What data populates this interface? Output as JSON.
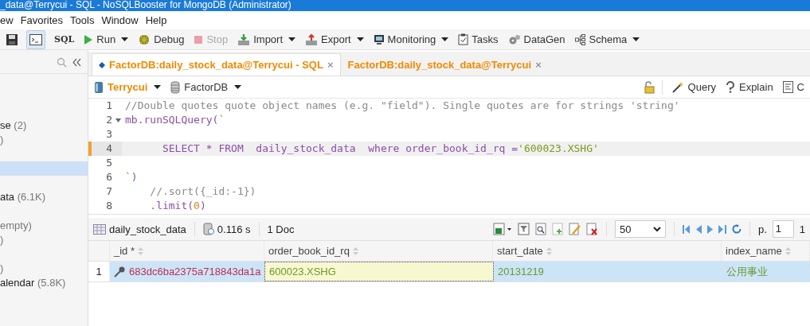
{
  "window": {
    "title": "_data@Terrycui - SQL - NoSQLBooster for MongoDB (Administrator)"
  },
  "menu": [
    "ew",
    "Favorites",
    "Tools",
    "Window",
    "Help"
  ],
  "toolbar": [
    {
      "kind": "save",
      "pressed": false
    },
    {
      "kind": "shell",
      "pressed": true
    },
    {
      "kind": "sql",
      "label": "SQL",
      "pressed": false
    },
    {
      "kind": "run",
      "label": "Run",
      "dropdown": true,
      "disabled": false
    },
    {
      "kind": "debug",
      "label": "Debug",
      "dropdown": false,
      "disabled": false
    },
    {
      "kind": "stop",
      "label": "Stop",
      "dropdown": false,
      "disabled": true
    },
    {
      "kind": "import",
      "label": "Import",
      "dropdown": true,
      "disabled": false
    },
    {
      "kind": "export",
      "label": "Export",
      "dropdown": true,
      "disabled": false
    },
    {
      "kind": "monitor",
      "label": "Monitoring",
      "dropdown": true,
      "disabled": false
    },
    {
      "kind": "tasks",
      "label": "Tasks",
      "dropdown": false,
      "disabled": false
    },
    {
      "kind": "gears",
      "label": "DataGen",
      "dropdown": false,
      "disabled": false
    },
    {
      "kind": "schema",
      "label": "Schema",
      "dropdown": true,
      "disabled": false
    }
  ],
  "sidebar": {
    "items": [
      {
        "label": "se",
        "count": "(2)",
        "selected": false
      },
      {
        "count": ")",
        "selected": false
      },
      {
        "selected": false
      },
      {
        "selected": true
      },
      {
        "selected": false
      },
      {
        "label": "ata",
        "count": "(6.1K)",
        "selected": false
      },
      {
        "selected": false
      },
      {
        "count": "empty)",
        "selected": false
      },
      {
        "count": ")",
        "selected": false
      },
      {
        "selected": false
      },
      {
        "count": ")",
        "selected": false
      },
      {
        "label": "alendar",
        "count": "(5.8K)",
        "selected": false
      }
    ]
  },
  "tabs": [
    {
      "label": "FactorDB:daily_stock_data@Terrycui - SQL",
      "close": "×",
      "selected": true,
      "modified": true
    },
    {
      "label": "FactorDB:daily_stock_data@Terrycui",
      "close": "×",
      "selected": false,
      "modified": false
    }
  ],
  "connection": {
    "server": "Terrycui",
    "database": "FactorDB",
    "actions": [
      {
        "kind": "query",
        "label": "Query"
      },
      {
        "kind": "explain",
        "label": "Explain"
      },
      {
        "kind": "code",
        "label": "C"
      }
    ]
  },
  "editor": {
    "lines": [
      {
        "number": "1",
        "foldable": false,
        "current": false,
        "tokens": [
          {
            "kind": "comment",
            "text": "//Double quotes quote object names (e.g. \"field\"). Single quotes are for strings 'string'"
          }
        ]
      },
      {
        "number": "2",
        "foldable": true,
        "current": false,
        "tokens": [
          {
            "kind": "ident",
            "text": "mb.runSQLQuery("
          },
          {
            "kind": "string",
            "text": "`"
          }
        ]
      },
      {
        "number": "3",
        "foldable": false,
        "current": false
      },
      {
        "number": "4",
        "foldable": false,
        "current": true,
        "tokens": [
          {
            "kind": "keyword",
            "text": "      SELECT * FROM  daily_stock_data  where order_book_id_rq ="
          },
          {
            "kind": "string",
            "text": "'600023.XSHG'"
          }
        ]
      },
      {
        "number": "5",
        "foldable": false,
        "current": false
      },
      {
        "number": "6",
        "foldable": false,
        "current": false,
        "tokens": [
          {
            "kind": "string",
            "text": "`"
          },
          {
            "kind": "ident",
            "text": ")"
          }
        ]
      },
      {
        "number": "7",
        "foldable": false,
        "current": false,
        "tokens": [
          {
            "kind": "comment",
            "text": "    //.sort({_id:-1})"
          }
        ]
      },
      {
        "number": "8",
        "foldable": false,
        "current": false,
        "tokens": [
          {
            "kind": "ident",
            "text": "    .limit("
          },
          {
            "kind": "number",
            "text": "0"
          },
          {
            "kind": "ident",
            "text": ")"
          }
        ]
      }
    ]
  },
  "results": {
    "collection": "daily_stock_data",
    "time": "0.116 s",
    "count": "1 Doc",
    "page_size": "50",
    "page_label": "p.",
    "page": "1",
    "page_total": "1",
    "columns": [
      {
        "label": "_id *"
      },
      {
        "label": "order_book_id_rq"
      },
      {
        "label": "start_date"
      },
      {
        "label": "index_name"
      }
    ],
    "rows": [
      {
        "number": "1",
        "selected": true,
        "cells": [
          {
            "kind": "id",
            "text": "683dc6ba2375a718843da1a",
            "focused": false
          },
          {
            "kind": "text",
            "text": "600023.XSHG",
            "focused": true
          },
          {
            "kind": "text",
            "text": "20131219",
            "focused": false
          },
          {
            "kind": "text",
            "text": "公用事业",
            "focused": false
          }
        ]
      }
    ]
  }
}
